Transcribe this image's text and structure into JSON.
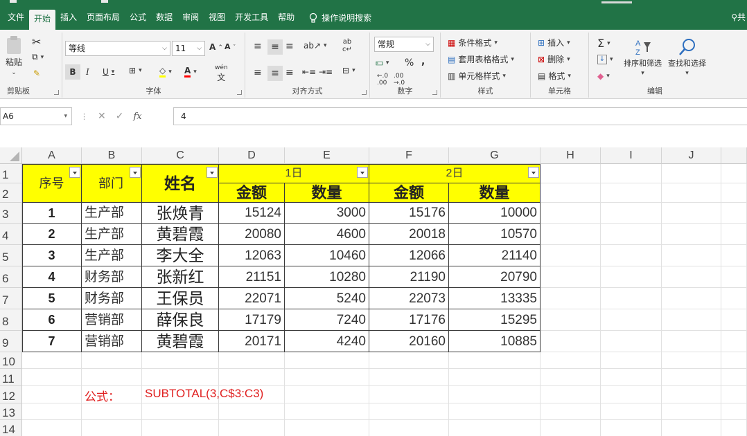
{
  "ribbon_tabs": [
    "文件",
    "开始",
    "插入",
    "页面布局",
    "公式",
    "数据",
    "审阅",
    "视图",
    "开发工具",
    "帮助"
  ],
  "tell_me": "操作说明搜索",
  "share": "共",
  "clipboard": {
    "paste": "粘贴",
    "label": "剪贴板"
  },
  "font": {
    "name": "等线",
    "size": "11",
    "label": "字体",
    "bold": "B",
    "italic": "I",
    "underline": "U",
    "grow": "A",
    "shrink": "A",
    "fontcolor": "A",
    "phonetic": "wén"
  },
  "alignment": {
    "label": "对齐方式"
  },
  "number": {
    "format": "常规",
    "label": "数字",
    "percent": "%",
    "comma": ","
  },
  "styles": {
    "conditional": "条件格式",
    "table": "套用表格格式",
    "cell": "单元格样式",
    "label": "样式"
  },
  "cells": {
    "insert": "插入",
    "delete": "删除",
    "format": "格式",
    "label": "单元格"
  },
  "editing": {
    "sort": "排序和筛选",
    "find": "查找和选择",
    "label": "编辑",
    "sigma": "Σ"
  },
  "formula_bar": {
    "name_box": "A6",
    "content": "4",
    "fx": "fx"
  },
  "columns": [
    "A",
    "B",
    "C",
    "D",
    "E",
    "F",
    "G",
    "H",
    "I",
    "J"
  ],
  "rows": [
    "1",
    "2",
    "3",
    "4",
    "5",
    "6",
    "7",
    "8",
    "9",
    "10",
    "11",
    "12",
    "13",
    "14"
  ],
  "table": {
    "h_seq": "序号",
    "h_dept": "部门",
    "h_name": "姓名",
    "h_day1": "1日",
    "h_day2": "2日",
    "h_amount1": "金额",
    "h_qty1": "数量",
    "h_amount2": "金额",
    "h_qty2": "数量",
    "rows": [
      {
        "seq": "1",
        "dept": "生产部",
        "name": "张焕青",
        "d1_amount": "15124",
        "d1_qty": "3000",
        "d2_amount": "15176",
        "d2_qty": "10000"
      },
      {
        "seq": "2",
        "dept": "生产部",
        "name": "黄碧霞",
        "d1_amount": "20080",
        "d1_qty": "4600",
        "d2_amount": "20018",
        "d2_qty": "10570"
      },
      {
        "seq": "3",
        "dept": "生产部",
        "name": "李大全",
        "d1_amount": "12063",
        "d1_qty": "10460",
        "d2_amount": "12066",
        "d2_qty": "21140"
      },
      {
        "seq": "4",
        "dept": "财务部",
        "name": "张新红",
        "d1_amount": "21151",
        "d1_qty": "10280",
        "d2_amount": "21190",
        "d2_qty": "20790"
      },
      {
        "seq": "5",
        "dept": "财务部",
        "name": "王保员",
        "d1_amount": "22071",
        "d1_qty": "5240",
        "d2_amount": "22073",
        "d2_qty": "13335"
      },
      {
        "seq": "6",
        "dept": "营销部",
        "name": "薛保良",
        "d1_amount": "17179",
        "d1_qty": "7240",
        "d2_amount": "17176",
        "d2_qty": "15295"
      },
      {
        "seq": "7",
        "dept": "营销部",
        "name": "黄碧霞",
        "d1_amount": "20171",
        "d1_qty": "4240",
        "d2_amount": "20160",
        "d2_qty": "10885"
      }
    ]
  },
  "formula_note": {
    "label": "公式：",
    "formula": "SUBTOTAL(3,C$3:C3)"
  },
  "colors": {
    "accent": "#217346",
    "header_fill": "#ffff00",
    "note": "#e02020"
  }
}
